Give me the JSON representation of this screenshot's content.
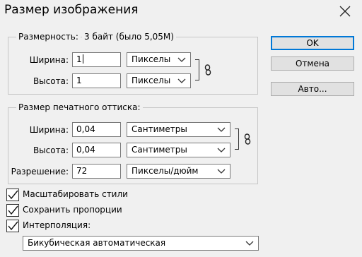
{
  "dialog": {
    "title": "Размер изображения"
  },
  "dimensions": {
    "legend": "Размерность:",
    "info": "3 байт (было 5,05M)",
    "width": {
      "label": "Ширина:",
      "value": "1",
      "unit": "Пикселы"
    },
    "height": {
      "label": "Высота:",
      "value": "1",
      "unit": "Пикселы"
    }
  },
  "print_size": {
    "legend": "Размер печатного оттиска:",
    "width": {
      "label": "Ширина:",
      "value": "0,04",
      "unit": "Сантиметры"
    },
    "height": {
      "label": "Высота:",
      "value": "0,04",
      "unit": "Сантиметры"
    },
    "resolution": {
      "label": "Разрешение:",
      "value": "72",
      "unit": "Пикселы/дюйм"
    }
  },
  "options": {
    "scale_styles": {
      "label": "Масштабировать стили",
      "checked": true
    },
    "constrain": {
      "label": "Сохранить пропорции",
      "checked": true
    },
    "resample": {
      "label": "Интерполяция:",
      "checked": true
    },
    "resample_method": "Бикубическая автоматическая"
  },
  "buttons": {
    "ok": "OK",
    "cancel": "Отмена",
    "auto": "Авто..."
  }
}
